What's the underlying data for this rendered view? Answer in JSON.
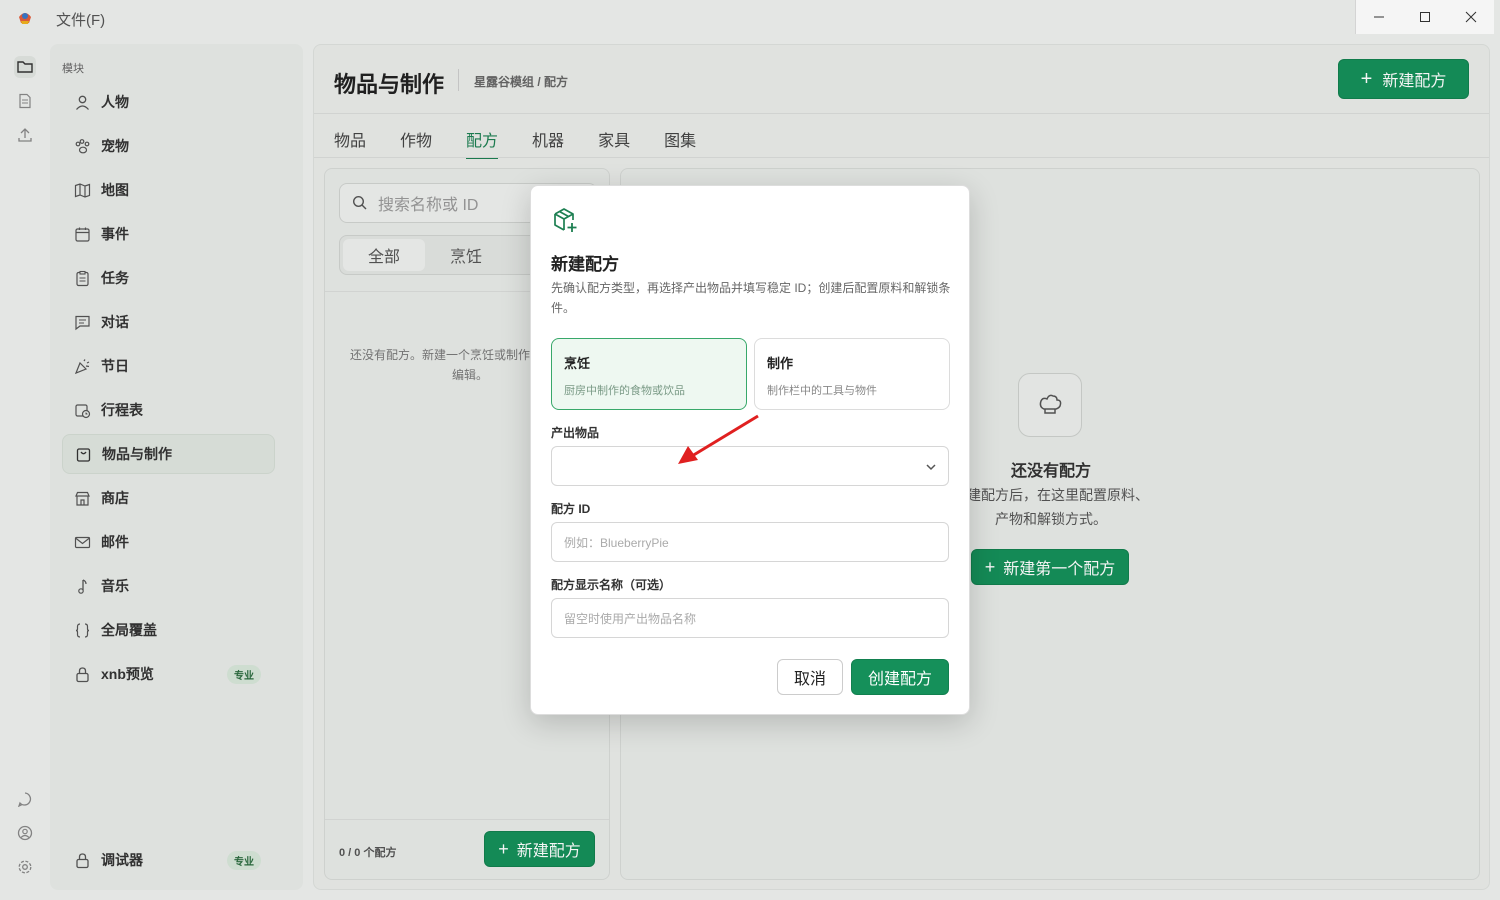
{
  "titlebar": {
    "file_menu": "文件(F)"
  },
  "sidebar": {
    "section_label": "模块",
    "items": [
      {
        "label": "人物",
        "icon": "person-icon"
      },
      {
        "label": "宠物",
        "icon": "paw-icon"
      },
      {
        "label": "地图",
        "icon": "map-icon"
      },
      {
        "label": "事件",
        "icon": "calendar-icon"
      },
      {
        "label": "任务",
        "icon": "clipboard-icon"
      },
      {
        "label": "对话",
        "icon": "chat-icon"
      },
      {
        "label": "节日",
        "icon": "party-icon"
      },
      {
        "label": "行程表",
        "icon": "schedule-icon"
      },
      {
        "label": "物品与制作",
        "icon": "bag-icon"
      },
      {
        "label": "商店",
        "icon": "store-icon"
      },
      {
        "label": "邮件",
        "icon": "mail-icon"
      },
      {
        "label": "音乐",
        "icon": "music-icon"
      },
      {
        "label": "全局覆盖",
        "icon": "braces-icon"
      },
      {
        "label": "xnb预览",
        "icon": "lock-icon",
        "badge": "专业"
      }
    ],
    "debugger": {
      "label": "调试器",
      "badge": "专业"
    }
  },
  "header": {
    "title": "物品与制作",
    "breadcrumb": "星露谷模组 / 配方",
    "new_button": "新建配方"
  },
  "tabs": [
    "物品",
    "作物",
    "配方",
    "机器",
    "家具",
    "图集"
  ],
  "active_tab": "配方",
  "list": {
    "search_placeholder": "搜索名称或 ID",
    "filters": [
      "全部",
      "烹饪"
    ],
    "empty_text": "还没有配方。新建一个烹饪或制作配方后即可编辑。",
    "count": "0 / 0 个配方",
    "new_button": "新建配方"
  },
  "detail": {
    "empty_title": "还没有配方",
    "empty_desc": "新建配方后，在这里配置原料、产物和解锁方式。",
    "new_first_button": "新建第一个配方"
  },
  "modal": {
    "title": "新建配方",
    "description": "先确认配方类型，再选择产出物品并填写稳定 ID；创建后配置原料和解锁条件。",
    "types": [
      {
        "title": "烹饪",
        "subtitle": "厨房中制作的食物或饮品",
        "selected": true
      },
      {
        "title": "制作",
        "subtitle": "制作栏中的工具与物件",
        "selected": false
      }
    ],
    "output_label": "产出物品",
    "output_value": "",
    "id_label": "配方 ID",
    "id_placeholder": "例如：BlueberryPie",
    "name_label": "配方显示名称（可选）",
    "name_placeholder": "留空时使用产出物品名称",
    "cancel": "取消",
    "create": "创建配方"
  },
  "colors": {
    "accent": "#15905a",
    "annotation_arrow": "#e02020"
  }
}
